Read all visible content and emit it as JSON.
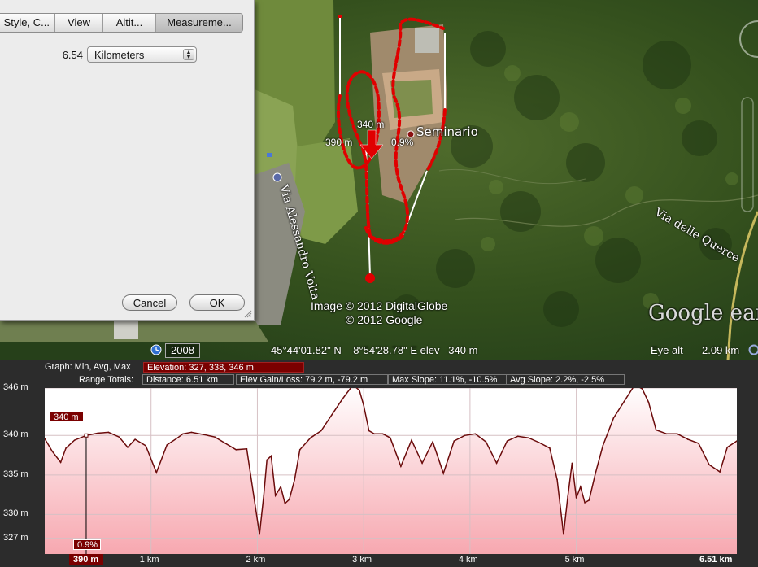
{
  "dialog": {
    "tabs": [
      "Style, C...",
      "View",
      "Altit...",
      "Measureme..."
    ],
    "active_tab": "Measureme...",
    "measure_value": "6.54",
    "unit_selected": "Kilometers",
    "cancel_label": "Cancel",
    "ok_label": "OK"
  },
  "map": {
    "place_label": "Seminario",
    "road_label_1": "Via Alessandro Volta",
    "road_label_2": "Via delle Querce",
    "marker_elev": "340 m",
    "marker_left": "390 m",
    "marker_slope": "0.9%",
    "copyright_1": "Image © 2012 DigitalGlobe",
    "copyright_2": "© 2012 Google",
    "logo": "Google earth"
  },
  "status": {
    "year": "2008",
    "coords": "45°44'01.82\" N    8°54'28.78\" E elev   340 m",
    "eye_alt_label": "Eye alt",
    "eye_alt_value": "2.09 km"
  },
  "profile": {
    "graph_label": "Graph: Min, Avg, Max",
    "elevation": "Elevation: 327, 338, 346 m",
    "range_label": "Range Totals:",
    "distance": "Distance: 6.51 km",
    "elev_gain": "Elev Gain/Loss: 79.2 m, -79.2 m",
    "max_slope": "Max Slope: 11.1%, -10.5%",
    "avg_slope": "Avg Slope: 2.2%, -2.5%",
    "y_ticks": [
      "346 m",
      "340 m",
      "335 m",
      "330 m",
      "327 m"
    ],
    "x_ticks": [
      "1 km",
      "2 km",
      "3 km",
      "4 km",
      "5 km"
    ],
    "x_end": "6.51 km",
    "cursor_x": "390 m",
    "cursor_elev": "340 m",
    "cursor_slope": "0.9%"
  },
  "colors": {
    "track": "#e00000",
    "profile_fill_top": "#ffffff",
    "profile_fill_bottom": "#f7a8b0",
    "elevation_box": "#7a0000"
  },
  "chart_data": {
    "type": "area",
    "xlabel": "",
    "ylabel": "",
    "x_unit": "km",
    "y_unit": "m",
    "xlim": [
      0,
      6.51
    ],
    "ylim": [
      325,
      346
    ],
    "x": [
      0,
      0.07,
      0.15,
      0.2,
      0.28,
      0.39,
      0.5,
      0.6,
      0.7,
      0.78,
      0.85,
      0.95,
      1.05,
      1.15,
      1.25,
      1.3,
      1.38,
      1.5,
      1.6,
      1.7,
      1.8,
      1.9,
      1.98,
      2.02,
      2.06,
      2.09,
      2.13,
      2.17,
      2.22,
      2.26,
      2.3,
      2.35,
      2.4,
      2.5,
      2.6,
      2.7,
      2.8,
      2.9,
      2.96,
      3.0,
      3.05,
      3.1,
      3.18,
      3.25,
      3.35,
      3.45,
      3.55,
      3.65,
      3.75,
      3.85,
      3.95,
      4.05,
      4.15,
      4.25,
      4.35,
      4.45,
      4.55,
      4.65,
      4.75,
      4.82,
      4.88,
      4.92,
      4.96,
      5.0,
      5.04,
      5.08,
      5.12,
      5.18,
      5.25,
      5.35,
      5.45,
      5.55,
      5.62,
      5.68,
      5.75,
      5.85,
      5.95,
      6.05,
      6.15,
      6.25,
      6.35,
      6.42,
      6.51
    ],
    "values": [
      339.6,
      338,
      336.6,
      338.4,
      339.4,
      340,
      340.3,
      340.4,
      339.8,
      338.5,
      339.5,
      338.7,
      335.3,
      338.8,
      339.7,
      340.2,
      340.4,
      340.1,
      339.8,
      339,
      338.2,
      338.3,
      331.1,
      327.5,
      332.4,
      336.9,
      337.4,
      332.4,
      333.5,
      331.4,
      331.9,
      334.4,
      338.2,
      339.7,
      340.6,
      342.6,
      344.6,
      346.4,
      345.7,
      343.8,
      340.6,
      340.2,
      340.2,
      339.7,
      336.1,
      339.4,
      336.5,
      339.2,
      335.2,
      339.3,
      340,
      340.2,
      339.2,
      336.5,
      339.3,
      339.9,
      339.7,
      339.1,
      338.4,
      334.4,
      327.5,
      332.3,
      336.5,
      332.1,
      333.5,
      331.5,
      331.8,
      335.2,
      338.7,
      342.2,
      344.3,
      346.4,
      345.9,
      344.2,
      340.7,
      340.2,
      340.2,
      339.5,
      339,
      336.3,
      335.4,
      338.5,
      339.3
    ],
    "grid": true
  }
}
